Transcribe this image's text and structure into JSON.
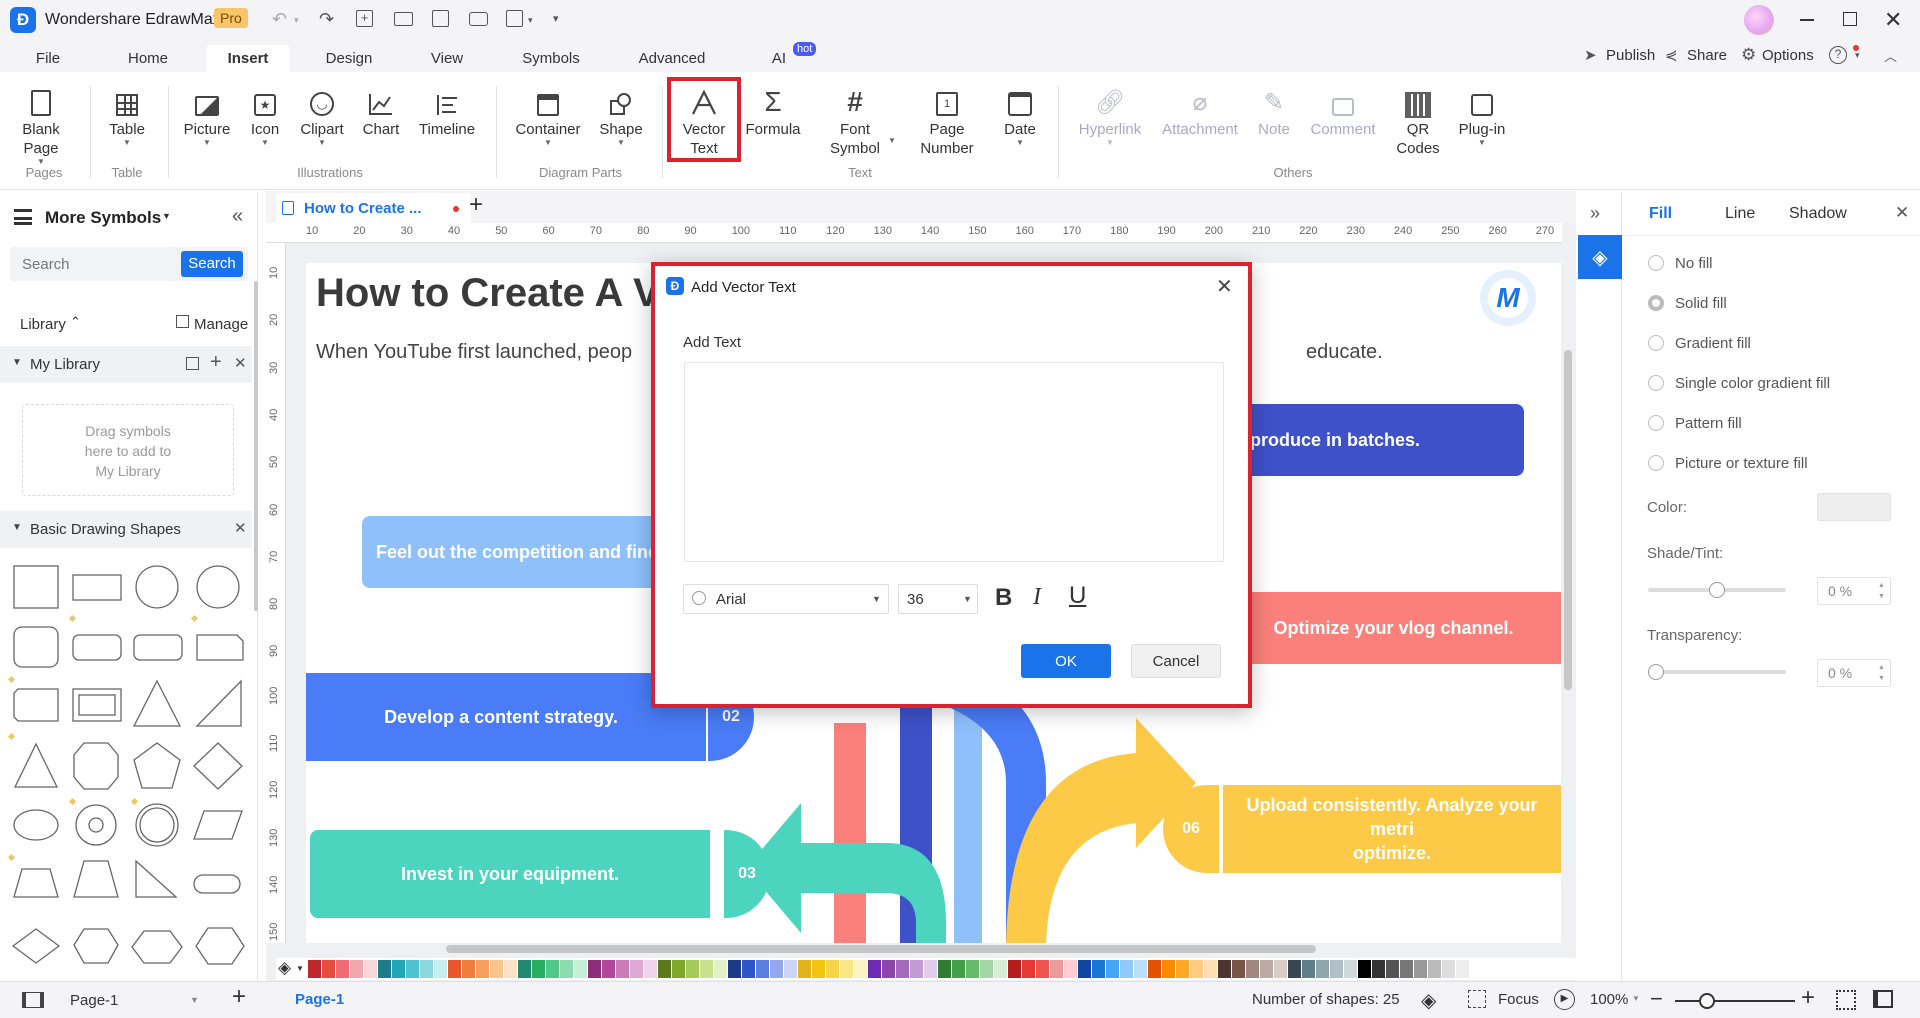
{
  "app": {
    "title": "Wondershare EdrawMax",
    "badge": "Pro"
  },
  "window_controls": [
    "minimize",
    "restore",
    "close"
  ],
  "menu": {
    "items": [
      "File",
      "Home",
      "Insert",
      "Design",
      "View",
      "Symbols",
      "Advanced",
      "AI"
    ],
    "active": "Insert",
    "ai_badge": "hot",
    "right": {
      "publish": "Publish",
      "share": "Share",
      "options": "Options"
    }
  },
  "ribbon": {
    "blank_page": "Blank Page",
    "table": "Table",
    "picture": "Picture",
    "icon": "Icon",
    "clipart": "Clipart",
    "chart": "Chart",
    "timeline": "Timeline",
    "container": "Container",
    "shape": "Shape",
    "vector_text_1": "Vector",
    "vector_text_2": "Text",
    "formula": "Formula",
    "font_symbol_1": "Font",
    "font_symbol_2": "Symbol",
    "page_number_1": "Page",
    "page_number_2": "Number",
    "date": "Date",
    "hyperlink": "Hyperlink",
    "attachment": "Attachment",
    "note": "Note",
    "comment": "Comment",
    "qr_codes_1": "QR",
    "qr_codes_2": "Codes",
    "plugin": "Plug-in",
    "groups": {
      "pages": "Pages",
      "table": "Table",
      "illustrations": "Illustrations",
      "diagram_parts": "Diagram Parts",
      "text": "Text",
      "others": "Others"
    }
  },
  "left_panel": {
    "title": "More Symbols",
    "search_placeholder": "Search",
    "search_button": "Search",
    "library": "Library",
    "manage": "Manage",
    "my_library": "My Library",
    "drag_hint_1": "Drag symbols",
    "drag_hint_2": "here to add to",
    "drag_hint_3": "My Library",
    "basic_shapes": "Basic Drawing Shapes"
  },
  "doc_tab": {
    "title": "How to Create ..."
  },
  "ruler": {
    "h": [
      "10",
      "20",
      "30",
      "40",
      "50",
      "60",
      "70",
      "80",
      "90",
      "100",
      "110",
      "120",
      "130",
      "140",
      "150",
      "160",
      "170",
      "180",
      "190",
      "200",
      "210",
      "220",
      "230",
      "240",
      "250",
      "260",
      "270"
    ],
    "v": [
      "10",
      "20",
      "30",
      "40",
      "50",
      "60",
      "70",
      "80",
      "90",
      "100",
      "110",
      "120",
      "130",
      "140",
      "150"
    ]
  },
  "canvas": {
    "heading": "How to Create A V",
    "subtitle_left": "When YouTube first launched, peop",
    "subtitle_right": "educate.",
    "step_top_right": "d produce in batches.",
    "step_competition": "Feel out the competition and find",
    "step_optimize": "Optimize your vlog channel.",
    "step_strategy": "Develop a content strategy.",
    "num_02": "02",
    "num_03": "03",
    "num_06": "06",
    "step_upload_1": "Upload consistently. Analyze your metri",
    "step_upload_2": "optimize.",
    "step_equipment": "Invest in your equipment."
  },
  "modal": {
    "title": "Add Vector Text",
    "add_text_label": "Add Text",
    "font": "Arial",
    "size": "36",
    "ok": "OK",
    "cancel": "Cancel"
  },
  "right_panel": {
    "tabs": [
      "Fill",
      "Line",
      "Shadow"
    ],
    "active_tab": "Fill",
    "options": [
      "No fill",
      "Solid fill",
      "Gradient fill",
      "Single color gradient fill",
      "Pattern fill",
      "Picture or texture fill"
    ],
    "selected": "Solid fill",
    "color_label": "Color:",
    "shade_label": "Shade/Tint:",
    "shade_value": "0 %",
    "transparency_label": "Transparency:",
    "transparency_value": "0 %",
    "shade_level": 0.5,
    "transparency_level": 0
  },
  "status": {
    "page_selector": "Page-1",
    "page_tab": "Page-1",
    "shapes": "Number of shapes: 25",
    "focus": "Focus",
    "zoom": "100%"
  },
  "colors": {
    "accent": "#1a73e8",
    "highlight": "#d9232f",
    "blue_step": "#4a7cf7",
    "teal_step": "#4dd4bf",
    "red_step": "#fb7f7a",
    "yellow_step": "#fdca47",
    "indigo_step": "#3f51c9",
    "light_blue_step": "#8fc0fb"
  },
  "palette": [
    "#c0272d",
    "#e74c3c",
    "#ef6b73",
    "#f4a6ad",
    "#f8d7da",
    "#1e7b8c",
    "#22a5b5",
    "#4cc3cf",
    "#8dd8df",
    "#c6eef1",
    "#e8572a",
    "#f07d3e",
    "#f5a05e",
    "#f9c58c",
    "#fde3c6",
    "#1f8a70",
    "#27ae60",
    "#52c78a",
    "#8ddbb0",
    "#c7eed8",
    "#8e2d7a",
    "#b0479a",
    "#c97ab8",
    "#dfa9d3",
    "#f0d5ea",
    "#5a7a1e",
    "#7fa829",
    "#a6c95a",
    "#c9e08e",
    "#e4f0c7",
    "#1b3a8a",
    "#2c56c6",
    "#5b7fe0",
    "#93a9ec",
    "#c9d4f6",
    "#e0b41a",
    "#f1c40f",
    "#f5d547",
    "#f9e686",
    "#fcf3c3",
    "#6c2bb0",
    "#8e44ad",
    "#a569bd",
    "#c39bd3",
    "#e1cde9",
    "#2f7d32",
    "#43a047",
    "#66bb6a",
    "#a5d6a7",
    "#d7edd8",
    "#b71c1c",
    "#e53935",
    "#ef5350",
    "#ef9a9a",
    "#ffcdd2",
    "#0d47a1",
    "#1976d2",
    "#42a5f5",
    "#90caf9",
    "#bbdefb",
    "#e65100",
    "#fb8c00",
    "#ffa726",
    "#ffcc80",
    "#ffe0b2",
    "#4e342e",
    "#795548",
    "#a1887f",
    "#bcaaa4",
    "#d7ccc8",
    "#37474f",
    "#607d8b",
    "#90a4ae",
    "#b0bec5",
    "#cfd8dc",
    "#000000",
    "#333333",
    "#555555",
    "#777777",
    "#999999",
    "#bbbbbb",
    "#dddddd",
    "#eeeeee",
    "#ffffff"
  ]
}
